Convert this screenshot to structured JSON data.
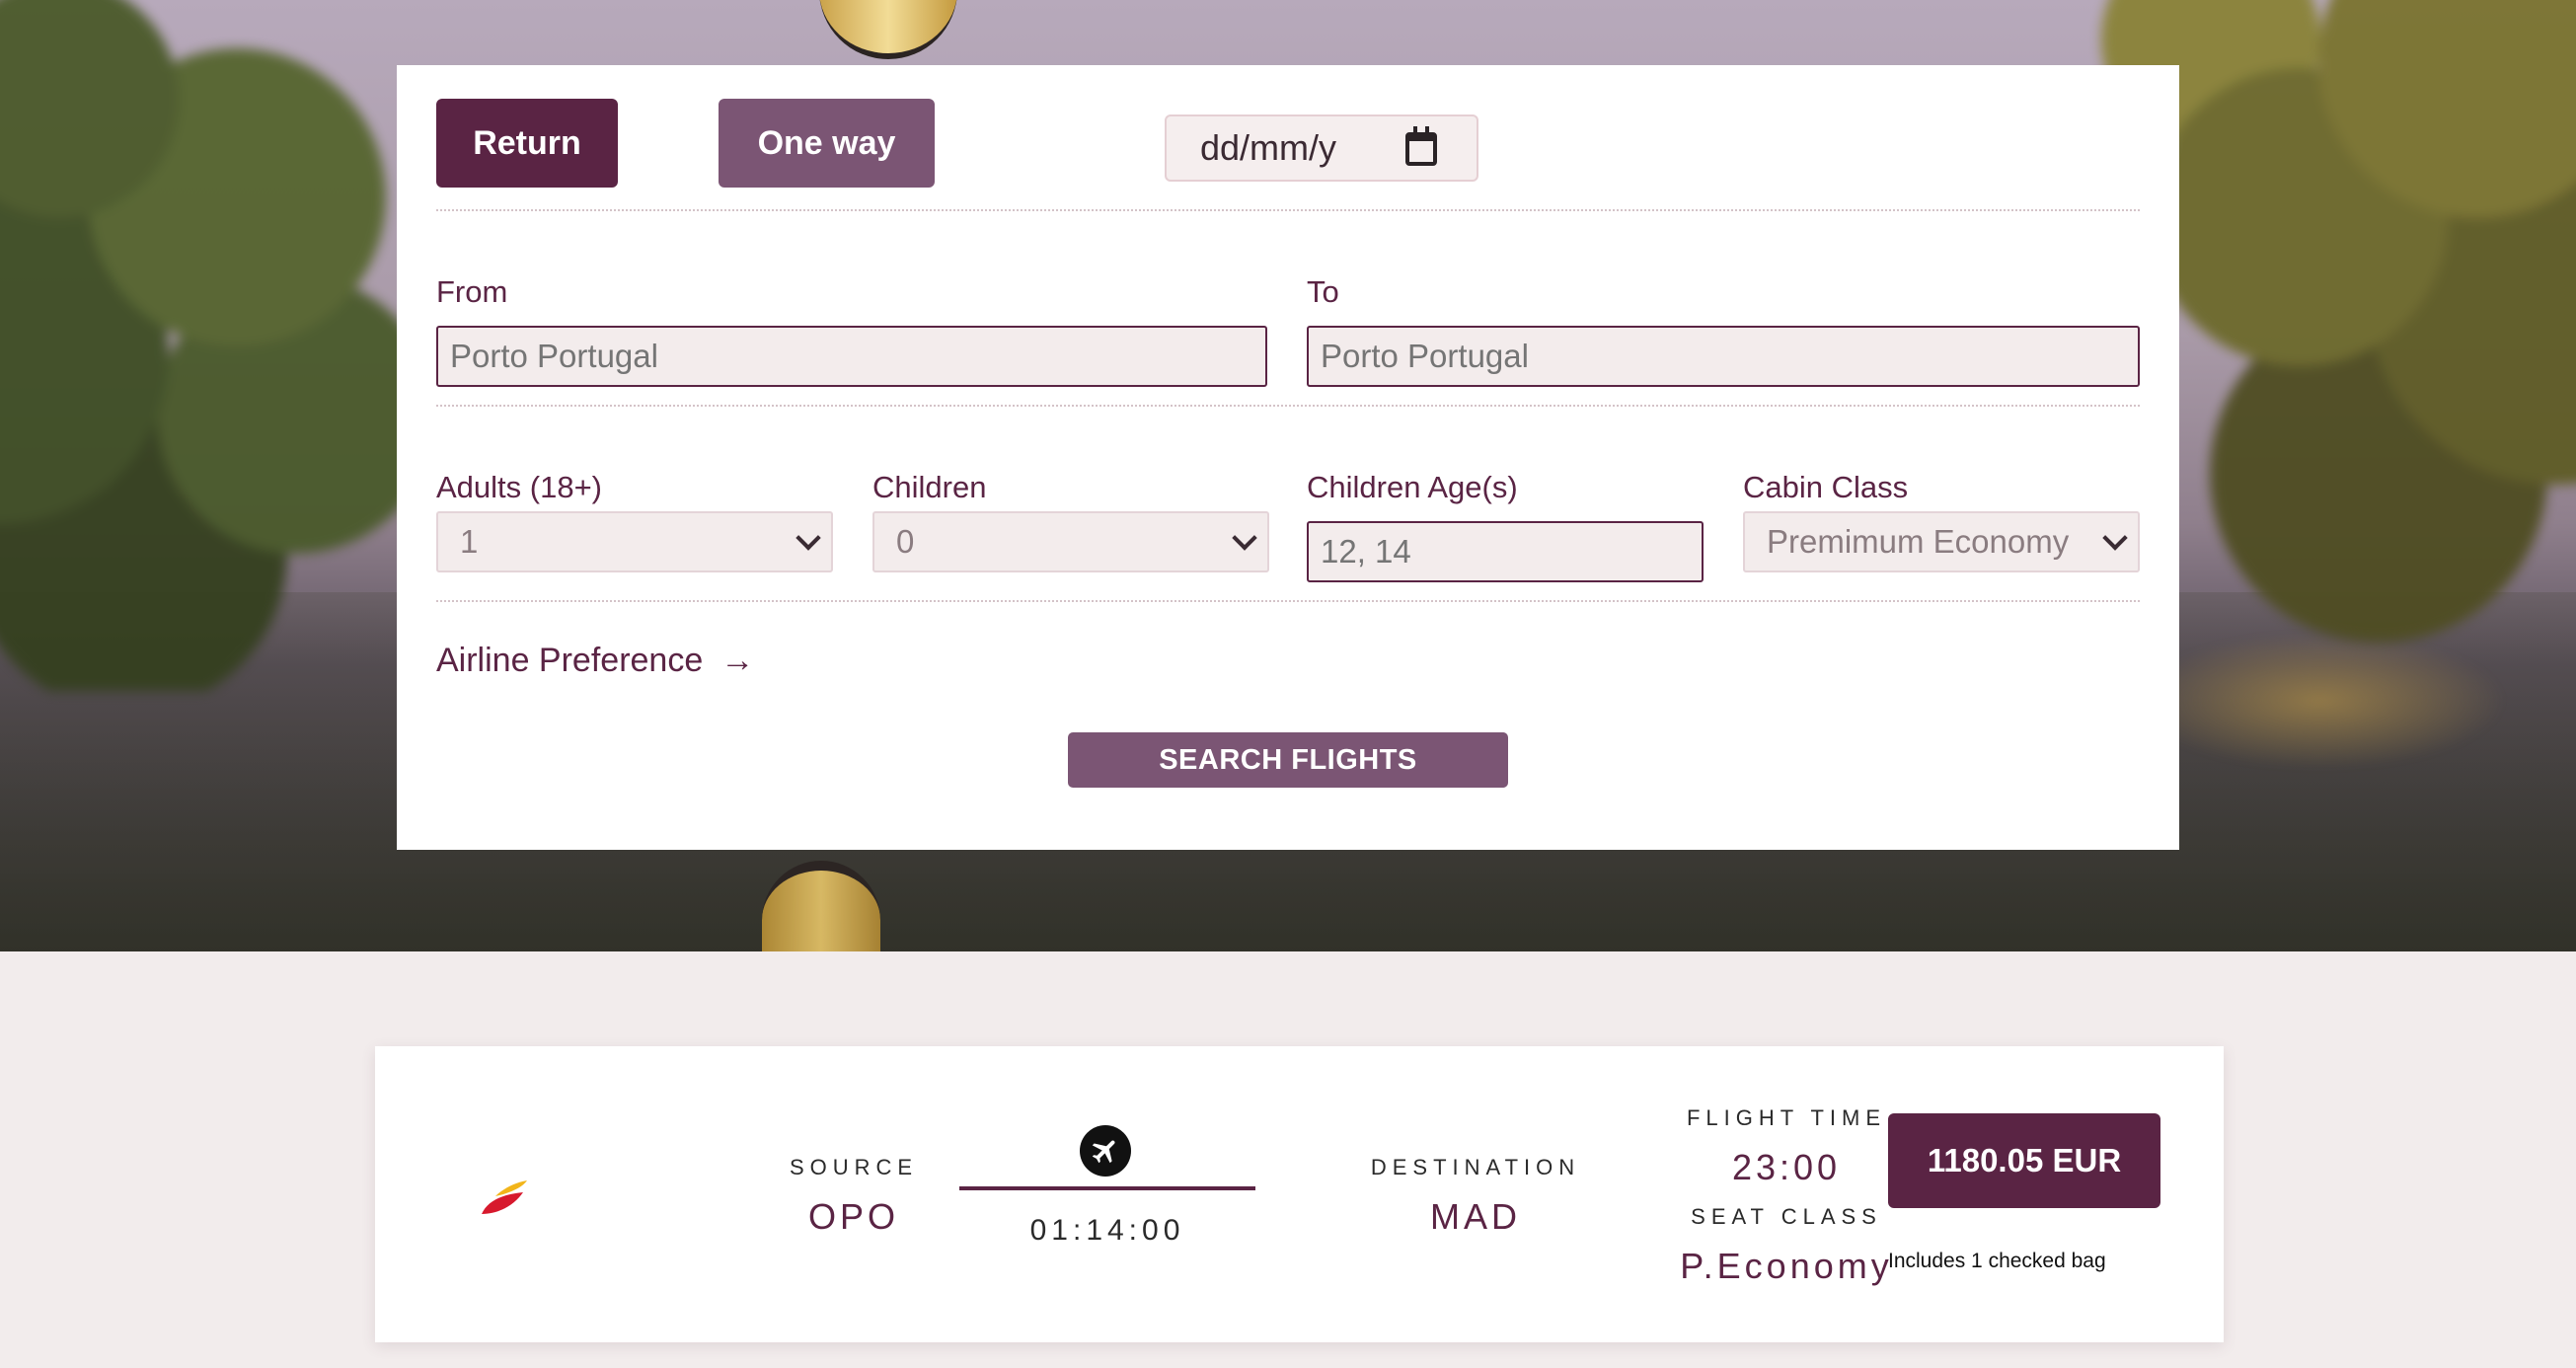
{
  "search": {
    "trip_types": {
      "return_label": "Return",
      "oneway_label": "One way"
    },
    "date": {
      "value": "dd/mm/y"
    },
    "from": {
      "label": "From",
      "placeholder": "Porto Portugal"
    },
    "to": {
      "label": "To",
      "placeholder": "Porto Portugal"
    },
    "adults": {
      "label": "Adults (18+)",
      "value": "1"
    },
    "children": {
      "label": "Children",
      "value": "0"
    },
    "children_ages": {
      "label": "Children Age(s)",
      "placeholder": "12, 14"
    },
    "cabin_class": {
      "label": "Cabin Class",
      "value": "Premimum Economy"
    },
    "airline_preference": {
      "label": "Airline Preference",
      "arrow": "→"
    },
    "search_button": "SEARCH FLIGHTS"
  },
  "result": {
    "source_caption": "SOURCE",
    "source": "OPO",
    "duration": "01:14:00",
    "destination_caption": "DESTINATION",
    "destination": "MAD",
    "flight_time_caption": "FLIGHT TIME",
    "flight_time": "23:00",
    "seat_class_caption": "SEAT CLASS",
    "seat_class": "P.Economy",
    "price": "1180.05 EUR",
    "bag_note": "Includes 1 checked bag",
    "icons": {
      "airline": "airline-logo",
      "plane": "plane-icon"
    }
  },
  "colors": {
    "brand": "#5a2444",
    "brand_light": "#7b5574",
    "page_bg": "#f2ecec"
  }
}
